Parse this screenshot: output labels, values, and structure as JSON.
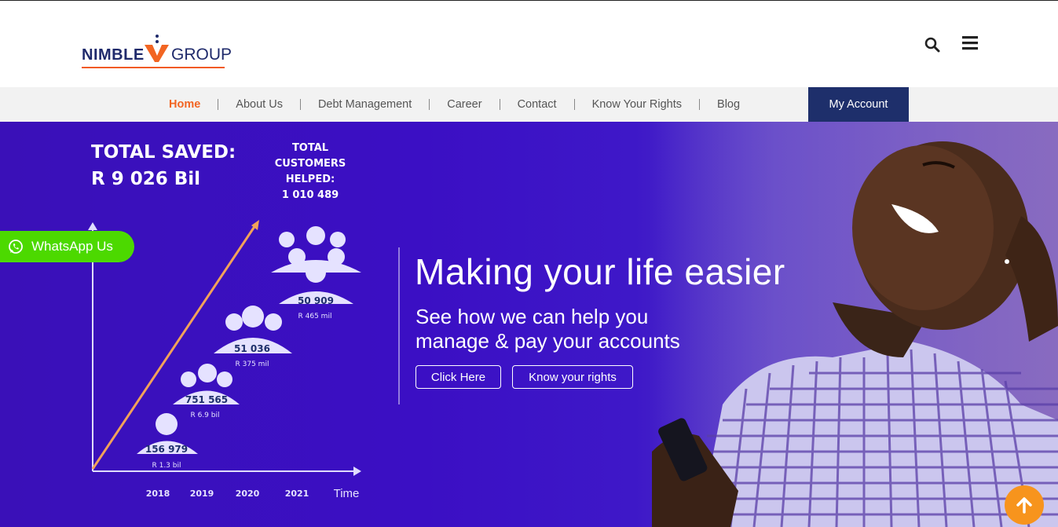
{
  "brand": {
    "name_left": "NIMBLE",
    "name_right": "GROUP",
    "accent": "#f26522",
    "navy": "#1e2f6b"
  },
  "header": {
    "icons": [
      "search-icon",
      "hamburger-menu-icon"
    ]
  },
  "nav": {
    "items": [
      {
        "label": "Home",
        "active": true
      },
      {
        "label": "About Us",
        "active": false
      },
      {
        "label": "Debt Management",
        "active": false
      },
      {
        "label": "Career",
        "active": false
      },
      {
        "label": "Contact",
        "active": false
      },
      {
        "label": "Know Your Rights",
        "active": false
      },
      {
        "label": "Blog",
        "active": false
      }
    ],
    "account_label": "My Account"
  },
  "hero": {
    "total_saved_label": "TOTAL SAVED:",
    "total_saved_value": "R 9 026 Bil",
    "customers_line1": "TOTAL CUSTOMERS",
    "customers_line2": "HELPED:",
    "customers_value": "1 010 489",
    "headline": "Making your life easier",
    "subline1": "See how we can help you",
    "subline2": "manage & pay your accounts",
    "button_primary": "Click Here",
    "button_secondary": "Know your rights",
    "bg_color": "#3b0fc4"
  },
  "infographic": {
    "years": [
      "2018",
      "2019",
      "2020",
      "2021"
    ],
    "axis_label": "Time",
    "groups": [
      {
        "count": "156 979",
        "amount": "R 1.3 bil"
      },
      {
        "count": "751 565",
        "amount": "R 6.9 bil"
      },
      {
        "count": "51 036",
        "amount": "R 375 mil"
      },
      {
        "count": "50 909",
        "amount": "R 465 mil"
      }
    ]
  },
  "whatsapp": {
    "label": "WhatsApp Us",
    "color": "#4cd900"
  },
  "scroll_top": {
    "icon": "arrow-up-icon",
    "color": "#f7941d"
  }
}
